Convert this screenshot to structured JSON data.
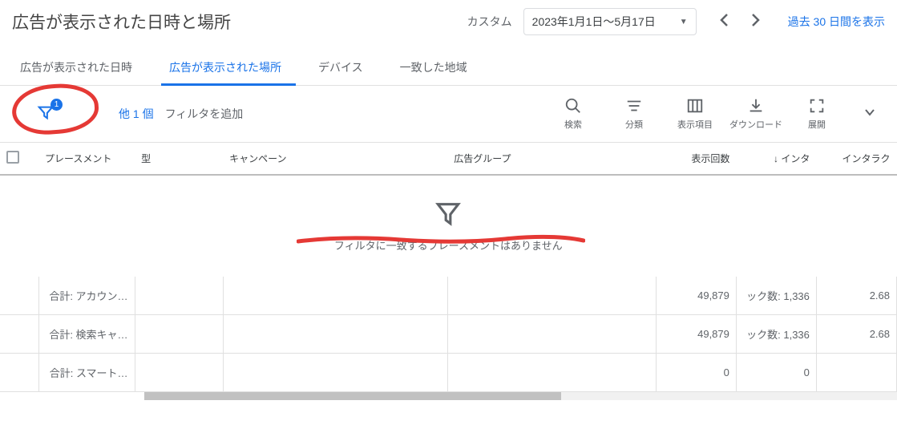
{
  "header": {
    "title": "広告が表示された日時と場所",
    "date_mode_label": "カスタム",
    "date_range": "2023年1月1日～5月17日",
    "last30_link": "過去 30 日間を表示"
  },
  "tabs": [
    {
      "label": "広告が表示された日時",
      "active": false
    },
    {
      "label": "広告が表示された場所",
      "active": true
    },
    {
      "label": "デバイス",
      "active": false
    },
    {
      "label": "一致した地域",
      "active": false
    }
  ],
  "filter": {
    "badge_count": "1",
    "extra_label": "他 1 個",
    "add_label": "フィルタを追加"
  },
  "actions": {
    "search": "検索",
    "segment": "分類",
    "columns": "表示項目",
    "download": "ダウンロード",
    "expand": "展開"
  },
  "table": {
    "columns": {
      "placement": "プレースメント",
      "type": "型",
      "campaign": "キャンペーン",
      "adgroup": "広告グループ",
      "impressions": "表示回数",
      "interaction": "インタ",
      "interaction2": "インタラク"
    },
    "empty_message": "フィルタに一致するプレースメントはありません",
    "rows": [
      {
        "label": "合計: アカウン…",
        "impressions": "49,879",
        "c2": "ック数: 1,336",
        "c3": "2.68"
      },
      {
        "label": "合計: 検索キャ…",
        "impressions": "49,879",
        "c2": "ック数: 1,336",
        "c3": "2.68"
      },
      {
        "label": "合計: スマート…",
        "impressions": "0",
        "c2": "0",
        "c3": ""
      }
    ],
    "sort_indicator": "↓"
  }
}
